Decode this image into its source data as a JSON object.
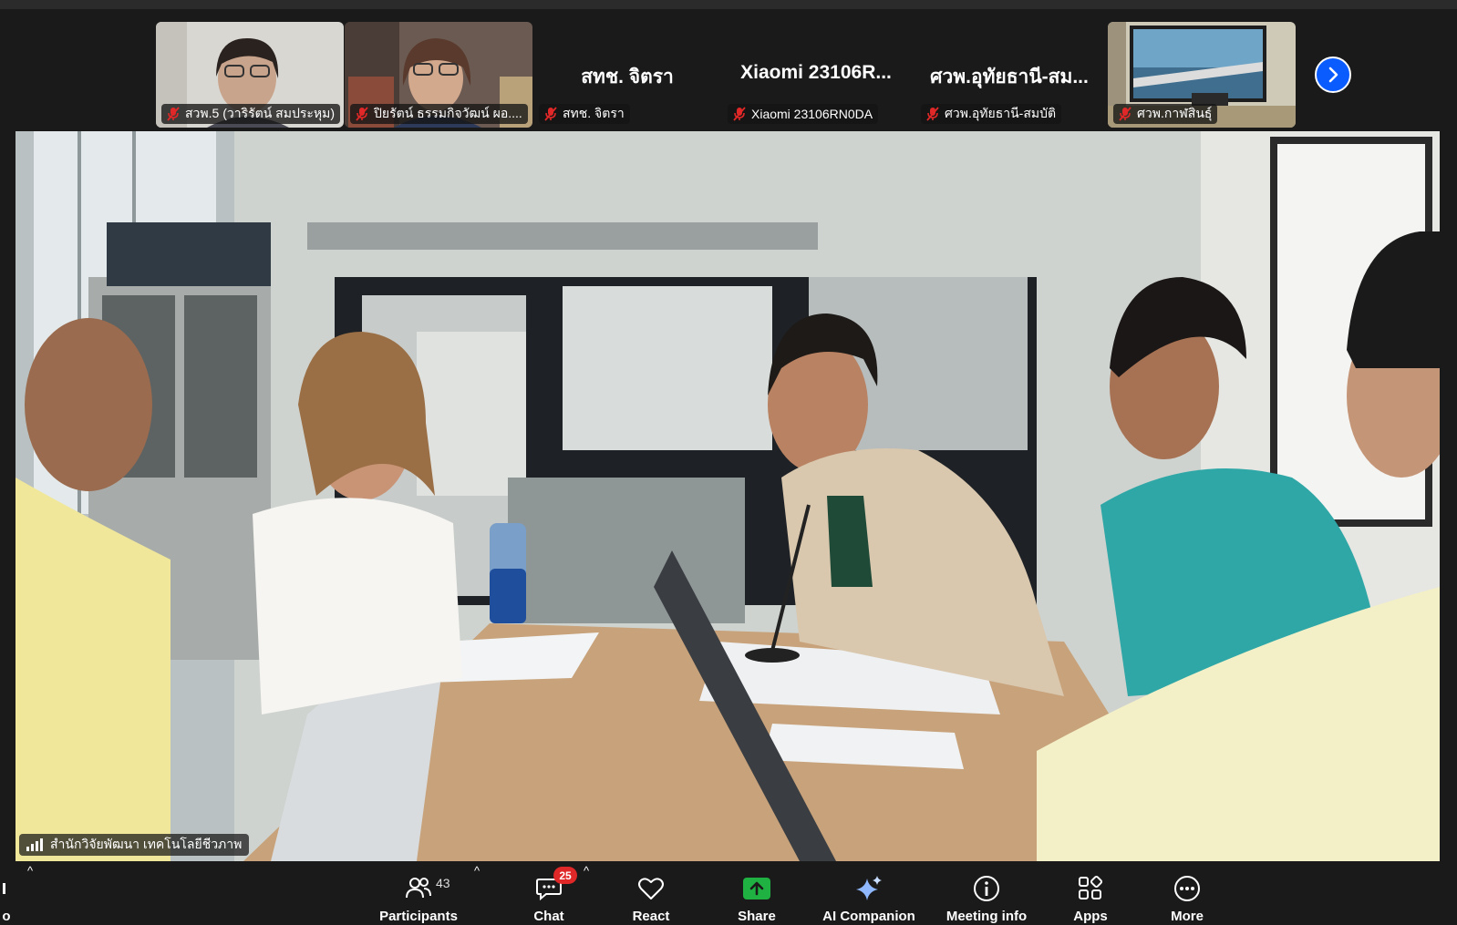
{
  "participants_strip": {
    "tiles": [
      {
        "name": "สวพ.5 (วาริรัตน์ สมประหุม)",
        "has_video": true
      },
      {
        "name": "ปิยรัตน์ ธรรมกิจวัฒน์ ผอ....",
        "has_video": true
      },
      {
        "name": "สทช. จิตรา",
        "display_name": "สทช. จิตรา",
        "has_video": false
      },
      {
        "name": "Xiaomi 23106RN0DA",
        "display_name": "Xiaomi 23106R...",
        "has_video": false
      },
      {
        "name": "ศวพ.อุทัยธานี-สมบัติ",
        "display_name": "ศวพ.อุทัยธานี-สม...",
        "has_video": false
      },
      {
        "name": "ศวพ.กาฬสินธุ์",
        "has_video": true
      }
    ]
  },
  "main_video": {
    "speaker_label": "สำนักวิจัยพัฒนา เทคโนโลยีชีวภาพ"
  },
  "toolbar": {
    "participants_label": "Participants",
    "participants_count": "43",
    "chat_label": "Chat",
    "chat_badge": "25",
    "react_label": "React",
    "share_label": "Share",
    "ai_label": "AI Companion",
    "info_label": "Meeting info",
    "apps_label": "Apps",
    "more_label": "More",
    "left_cut_label": "o"
  },
  "colors": {
    "share_green": "#1fb141",
    "accent_blue": "#0b5cff",
    "badge_red": "#e02828",
    "mic_muted_red": "#e02828"
  }
}
